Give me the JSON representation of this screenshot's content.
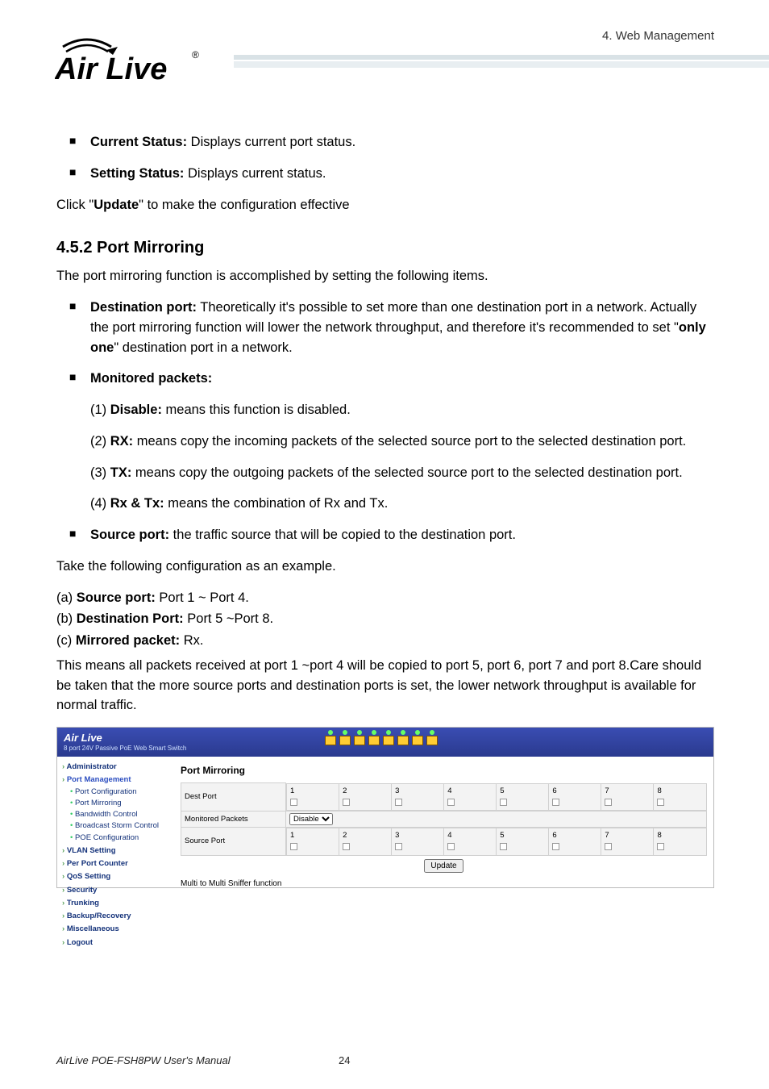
{
  "header": {
    "chapter": "4.  Web Management",
    "brand": "Air Live",
    "brand_mark": "®"
  },
  "body": {
    "bullets_top": [
      {
        "term": "Current Status:",
        "desc": " Displays current port status."
      },
      {
        "term": "Setting Status:",
        "desc": " Displays current status."
      }
    ],
    "click_update_pre": "Click \"",
    "click_update_bold": "Update",
    "click_update_post": "\" to make the configuration effective",
    "section_no": "4.5.2 Port Mirroring",
    "section_intro": "The port mirroring function is accomplished by setting the following items.",
    "dest_term": "Destination port:",
    "dest_desc_a": " Theoretically it's possible to set more than one destination port in a network. Actually the port mirroring function will lower the network throughput, and therefore it's recommended to set \"",
    "dest_desc_bold": "only one",
    "dest_desc_b": "\" destination port in a network.",
    "monpk_term": "Monitored packets:",
    "monpk_items": [
      {
        "pre": "(1) ",
        "b": "Disable:",
        "txt": " means this function is disabled."
      },
      {
        "pre": "(2) ",
        "b": "RX:",
        "txt": " means copy the incoming packets of the selected source port to the selected destination port."
      },
      {
        "pre": "(3) ",
        "b": "TX:",
        "txt": " means copy the outgoing packets of the selected source port to the selected destination port."
      },
      {
        "pre": "(4) ",
        "b": "Rx & Tx:",
        "txt": " means the combination of Rx and Tx."
      }
    ],
    "src_term": "Source port:",
    "src_desc": " the traffic source that will be copied to the destination port.",
    "example_intro": "Take the following configuration as an example.",
    "ex_a_pre": "(a) ",
    "ex_a_b": "Source port:",
    "ex_a_txt": " Port 1 ~ Port 4.",
    "ex_b_pre": "(b) ",
    "ex_b_b": "Destination Port:",
    "ex_b_txt": " Port 5 ~Port 8.",
    "ex_c_pre": "(c) ",
    "ex_c_b": "Mirrored packet:",
    "ex_c_txt": " Rx.",
    "example_result": "This means all packets received at port 1 ~port 4 will be copied to port 5, port 6, port 7 and port 8.Care should be taken that the more source ports and destination ports is set, the lower network throughput is available for normal traffic."
  },
  "shot": {
    "logo": "Air Live",
    "subtitle": "8 port 24V Passive PoE Web Smart Switch",
    "title": "Port Mirroring",
    "nav": {
      "admin": "Administrator",
      "pm": "Port Management",
      "pm_items": [
        "Port Configuration",
        "Port Mirroring",
        "Bandwidth Control",
        "Broadcast Storm Control",
        "POE Configuration"
      ],
      "rest": [
        "VLAN Setting",
        "Per Port Counter",
        "QoS Setting",
        "Security",
        "Trunking",
        "Backup/Recovery",
        "Miscellaneous",
        "Logout"
      ]
    },
    "rows": {
      "dest": "Dest Port",
      "mon": "Monitored Packets",
      "mon_val": "Disable",
      "src": "Source Port"
    },
    "ports": [
      "1",
      "2",
      "3",
      "4",
      "5",
      "6",
      "7",
      "8"
    ],
    "update": "Update",
    "note": "Multi to Multi Sniffer function"
  },
  "footer": {
    "manual": "AirLive POE-FSH8PW User's Manual",
    "page": "24"
  }
}
